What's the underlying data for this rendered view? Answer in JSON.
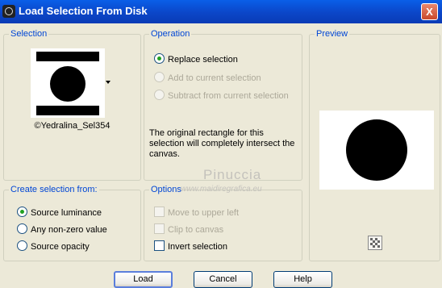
{
  "window": {
    "title": "Load Selection From Disk",
    "close_label": "X"
  },
  "selection_group": {
    "label": "Selection",
    "selected_file": "©Yedralina_Sel354"
  },
  "operation_group": {
    "label": "Operation",
    "options": [
      {
        "label": "Replace selection",
        "checked": true,
        "enabled": true
      },
      {
        "label": "Add to current selection",
        "checked": false,
        "enabled": false
      },
      {
        "label": "Subtract from current selection",
        "checked": false,
        "enabled": false
      }
    ],
    "description": "The original rectangle for this selection will completely intersect the canvas."
  },
  "preview_group": {
    "label": "Preview"
  },
  "create_group": {
    "label": "Create selection from:",
    "options": [
      {
        "label": "Source luminance",
        "checked": true
      },
      {
        "label": "Any non-zero value",
        "checked": false
      },
      {
        "label": "Source opacity",
        "checked": false
      }
    ]
  },
  "options_group": {
    "label": "Options",
    "items": [
      {
        "label": "Move to upper left",
        "checked": false,
        "enabled": false
      },
      {
        "label": "Clip to canvas",
        "checked": false,
        "enabled": false
      },
      {
        "label": "Invert selection",
        "checked": false,
        "enabled": true
      }
    ]
  },
  "watermark": {
    "name": "Pinuccia",
    "url": "www.maidiregrafica.eu"
  },
  "buttons": {
    "load": "Load",
    "cancel": "Cancel",
    "help": "Help"
  }
}
